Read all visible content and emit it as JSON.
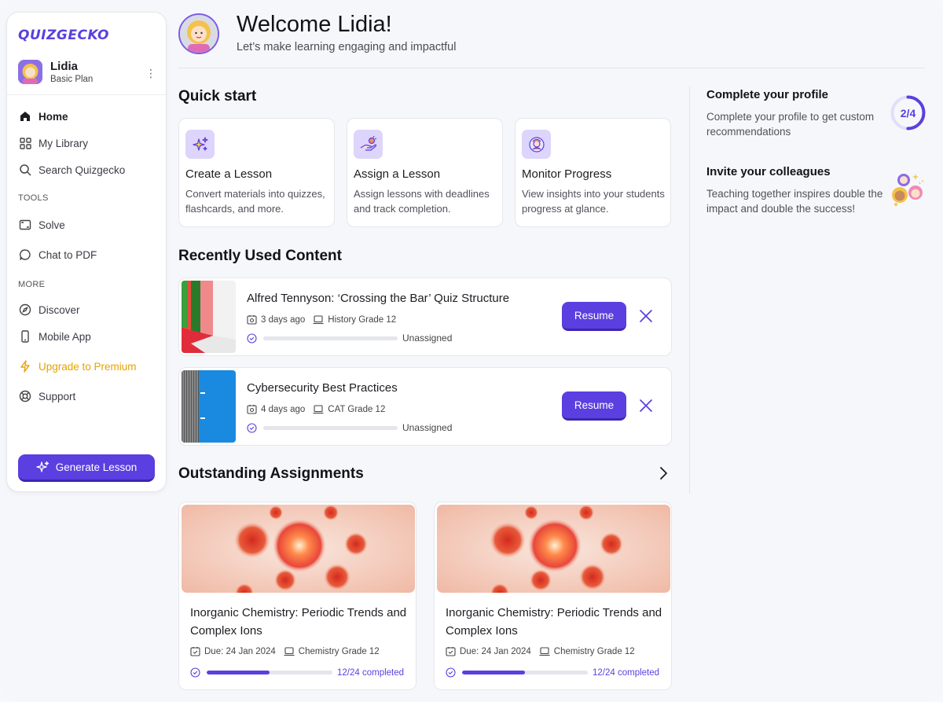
{
  "app": {
    "logo": "QUIZGECKO"
  },
  "user": {
    "name": "Lidia",
    "plan": "Basic Plan"
  },
  "sidebar": {
    "items": [
      {
        "label": "Home",
        "icon": "home-icon"
      },
      {
        "label": "My Library",
        "icon": "grid-icon"
      },
      {
        "label": "Search Quizgecko",
        "icon": "search-icon"
      }
    ],
    "tools_label": "TOOLS",
    "tools": [
      {
        "label": "Solve",
        "icon": "crop-icon"
      },
      {
        "label": "Chat to PDF",
        "icon": "chat-icon"
      }
    ],
    "more_label": "MORE",
    "more": [
      {
        "label": "Discover",
        "icon": "compass-icon"
      },
      {
        "label": "Mobile App",
        "icon": "phone-icon"
      },
      {
        "label": "Upgrade to Premium",
        "icon": "lightning-icon"
      },
      {
        "label": "Support",
        "icon": "lifebuoy-icon"
      }
    ],
    "generate_label": "Generate Lesson"
  },
  "header": {
    "welcome": "Welcome Lidia!",
    "subtitle": "Let’s make learning engaging and impactful"
  },
  "quick_start": {
    "title": "Quick start",
    "cards": [
      {
        "title": "Create a Lesson",
        "desc": "Convert materials into quizzes, flashcards, and more.",
        "icon": "sparkles-icon"
      },
      {
        "title": "Assign a Lesson",
        "desc": "Assign lessons with deadlines and track completion.",
        "icon": "hand-give-icon"
      },
      {
        "title": "Monitor Progress",
        "desc": "View insights into your students progress at glance.",
        "icon": "monitor-student-icon"
      }
    ]
  },
  "recent": {
    "title": "Recently Used Content",
    "items": [
      {
        "title": "Alfred Tennyson: ‘Crossing the Bar’ Quiz Structure",
        "time": "3 days ago",
        "class": "History Grade 12",
        "status": "Unassigned",
        "action": "Resume"
      },
      {
        "title": "Cybersecurity Best Practices",
        "time": "4 days ago",
        "class": "CAT Grade 12",
        "status": "Unassigned",
        "action": "Resume"
      }
    ]
  },
  "assignments": {
    "title": "Outstanding Assignments",
    "items": [
      {
        "title": "Inorganic Chemistry: Periodic Trends and Complex Ions",
        "due": "Due: 24 Jan 2024",
        "class": "Chemistry Grade 12",
        "progress": "12/24 completed",
        "fraction": 0.5
      },
      {
        "title": "Inorganic Chemistry: Periodic Trends and Complex Ions",
        "due": "Due: 24 Jan 2024",
        "class": "Chemistry Grade 12",
        "progress": "12/24 completed",
        "fraction": 0.5
      }
    ]
  },
  "right_panel": {
    "profile_title": "Complete your profile",
    "profile_desc": "Complete your profile to get custom recommendations",
    "profile_progress": "2/4",
    "profile_fraction": 0.5,
    "invite_title": "Invite your colleagues",
    "invite_desc": "Teaching together inspires double the impact and double the success!"
  },
  "colors": {
    "accent": "#5b3fe0",
    "premium": "#e4a400",
    "icon_bg": "#ddd5fb"
  }
}
